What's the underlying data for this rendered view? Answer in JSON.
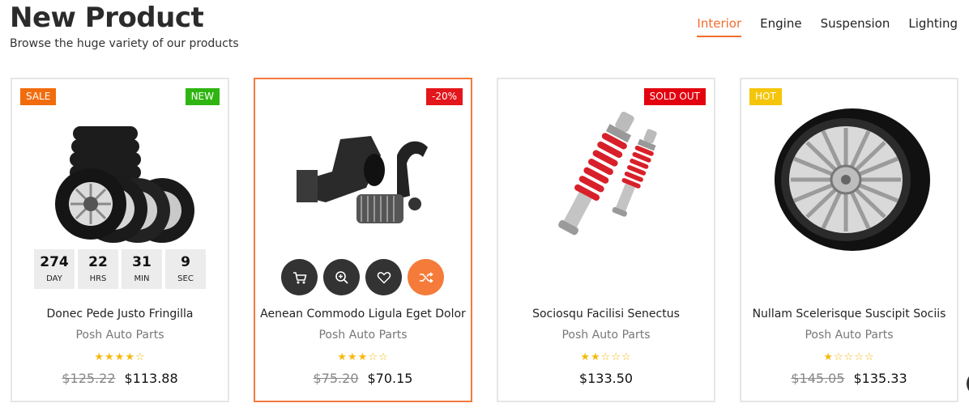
{
  "header": {
    "title": "New Product",
    "subtitle": "Browse the huge variety of our products"
  },
  "tabs": [
    {
      "label": "Interior",
      "active": true
    },
    {
      "label": "Engine",
      "active": false
    },
    {
      "label": "Suspension",
      "active": false
    },
    {
      "label": "Lighting",
      "active": false
    }
  ],
  "products": [
    {
      "name": "Donec Pede Justo Fringilla",
      "brand": "Posh Auto Parts",
      "rating": 4,
      "old_price": "$125.22",
      "price": "$113.88",
      "badges": [
        {
          "text": "SALE",
          "color": "#f26c0d",
          "side": "left"
        },
        {
          "text": "NEW",
          "color": "#2fb511",
          "side": "right"
        }
      ],
      "countdown": [
        {
          "value": "274",
          "unit": "DAY"
        },
        {
          "value": "22",
          "unit": "HRS"
        },
        {
          "value": "31",
          "unit": "MIN"
        },
        {
          "value": "9",
          "unit": "SEC"
        }
      ]
    },
    {
      "name": "Aenean Commodo Ligula Eget Dolor",
      "brand": "Posh Auto Parts",
      "rating": 3,
      "old_price": "$75.20",
      "price": "$70.15",
      "badges": [
        {
          "text": "-20%",
          "color": "#e3161b",
          "side": "right"
        }
      ],
      "actions": [
        "cart-icon",
        "zoom-icon",
        "heart-icon",
        "shuffle-icon"
      ]
    },
    {
      "name": "Sociosqu Facilisi Senectus",
      "brand": "Posh Auto Parts",
      "rating": 2,
      "old_price": "",
      "price": "$133.50",
      "badges": [
        {
          "text": "SOLD OUT",
          "color": "#e3000f",
          "side": "right"
        }
      ]
    },
    {
      "name": "Nullam Scelerisque Suscipit Sociis",
      "brand": "Posh Auto Parts",
      "rating": 1,
      "old_price": "$145.05",
      "price": "$135.33",
      "badges": [
        {
          "text": "HOT",
          "color": "#f5c50a",
          "side": "left"
        }
      ]
    }
  ],
  "colors": {
    "accent": "#f26c2d",
    "star": "#f5b90f"
  }
}
